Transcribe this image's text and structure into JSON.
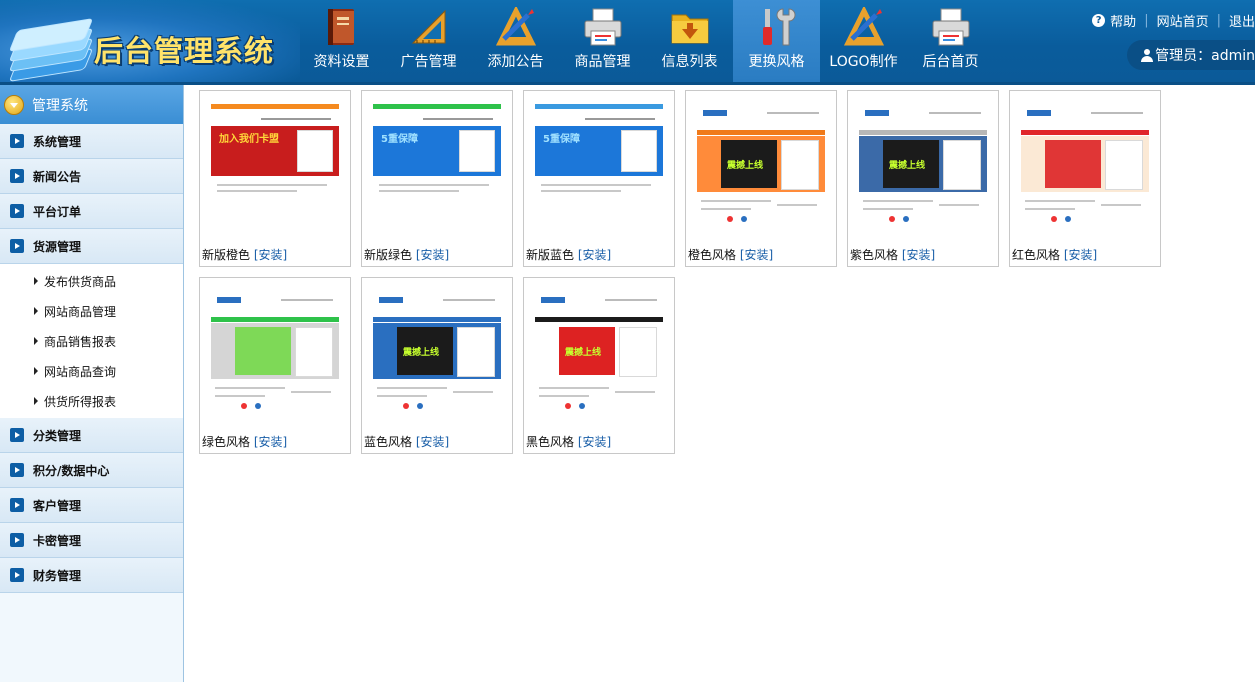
{
  "header": {
    "logo_title": "后台管理系统",
    "nav": [
      {
        "label": "资料设置",
        "icon": "book-icon"
      },
      {
        "label": "广告管理",
        "icon": "ruler-icon"
      },
      {
        "label": "添加公告",
        "icon": "pencil-ruler-icon"
      },
      {
        "label": "商品管理",
        "icon": "printer-icon"
      },
      {
        "label": "信息列表",
        "icon": "folder-download-icon"
      },
      {
        "label": "更换风格",
        "icon": "tools-icon",
        "active": true
      },
      {
        "label": "LOGO制作",
        "icon": "pencil-ruler-icon"
      },
      {
        "label": "后台首页",
        "icon": "printer-icon"
      }
    ],
    "top_links": {
      "help": "帮助",
      "site_home": "网站首页",
      "logout": "退出"
    },
    "admin_label": "管理员：admin"
  },
  "sidebar": {
    "title": "管理系统",
    "menus": [
      {
        "label": "系统管理"
      },
      {
        "label": "新闻公告"
      },
      {
        "label": "平台订单"
      },
      {
        "label": "货源管理",
        "children": [
          "发布供货商品",
          "网站商品管理",
          "商品销售报表",
          "网站商品查询",
          "供货所得报表"
        ]
      },
      {
        "label": "分类管理"
      },
      {
        "label": "积分/数据中心"
      },
      {
        "label": "客户管理"
      },
      {
        "label": "卡密管理"
      },
      {
        "label": "财务管理"
      }
    ]
  },
  "themes": [
    {
      "name": "新版橙色",
      "install": "[安装]",
      "thumb_text": "加入我们卡盟",
      "colors": {
        "top": "#f58a1f",
        "banner": "#c81d1d",
        "accent": "#ffd83a"
      }
    },
    {
      "name": "新版绿色",
      "install": "[安装]",
      "thumb_text": "5重保障",
      "colors": {
        "top": "#2ec24a",
        "banner": "#1c77d9",
        "accent": "#9fe0ff"
      }
    },
    {
      "name": "新版蓝色",
      "install": "[安装]",
      "thumb_text": "5重保障",
      "colors": {
        "top": "#3a9ae0",
        "banner": "#1c77d9",
        "accent": "#9fe0ff"
      }
    },
    {
      "name": "橙色风格",
      "install": "[安装]",
      "thumb_text": "震撼上线",
      "colors": {
        "top": "#ffffff",
        "nav": "#f07a1a",
        "banner": "#ff8b3a",
        "accent": "#1b1b1b"
      }
    },
    {
      "name": "紫色风格",
      "install": "[安装]",
      "thumb_text": "震撼上线",
      "colors": {
        "top": "#ffffff",
        "nav": "#b7b7b7",
        "banner": "#3b6aa8",
        "accent": "#1b1b1b"
      }
    },
    {
      "name": "红色风格",
      "install": "[安装]",
      "thumb_text": "",
      "colors": {
        "top": "#ffffff",
        "nav": "#e0262a",
        "banner": "#fbe9d5",
        "accent": "#e03636"
      }
    },
    {
      "name": "绿色风格",
      "install": "[安装]",
      "thumb_text": "",
      "colors": {
        "top": "#ffffff",
        "nav": "#2ec24a",
        "banner": "#d5d5d5",
        "accent": "#7ed957"
      }
    },
    {
      "name": "蓝色风格",
      "install": "[安装]",
      "thumb_text": "震撼上线",
      "colors": {
        "top": "#ffffff",
        "nav": "#2a6fc0",
        "banner": "#2a6fc0",
        "accent": "#1b1b1b"
      }
    },
    {
      "name": "黑色风格",
      "install": "[安装]",
      "thumb_text": "震撼上线",
      "colors": {
        "top": "#ffffff",
        "nav": "#1b1b1b",
        "banner": "#ffffff",
        "accent": "#d22"
      }
    }
  ]
}
